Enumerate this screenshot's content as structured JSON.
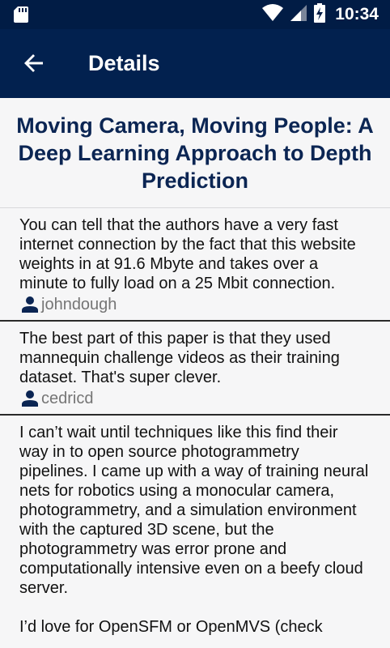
{
  "status_bar": {
    "time": "10:34",
    "icons": [
      "sd-card-icon",
      "wifi-icon",
      "signal-icon",
      "battery-charging-icon"
    ]
  },
  "app_bar": {
    "title": "Details",
    "back_icon": "arrow-back-icon"
  },
  "post": {
    "title": "Moving Camera, Moving People: A Deep Learning Approach to Depth Prediction"
  },
  "comments": [
    {
      "text": "You can tell that the authors have a very fast internet connection by the fact that this website weights in at 91.6 Mbyte and takes over a minute to fully load on a 25 Mbit connection.",
      "author": "johndough"
    },
    {
      "text": "The best part of this paper is that they used mannequin challenge videos as their training dataset. That's super clever.",
      "author": "cedricd"
    },
    {
      "text": "I can’t wait until techniques like this find their way in to open source photogrammetry pipelines. I came up with a way of training neural nets for robotics using a monocular camera, photogrammetry, and a simulation environment with the captured 3D scene, but the photogrammetry was error prone and computationally intensive even on a beefy cloud server.\n\nI’d love for OpenSFM or OpenMVS (check",
      "author": ""
    }
  ]
}
